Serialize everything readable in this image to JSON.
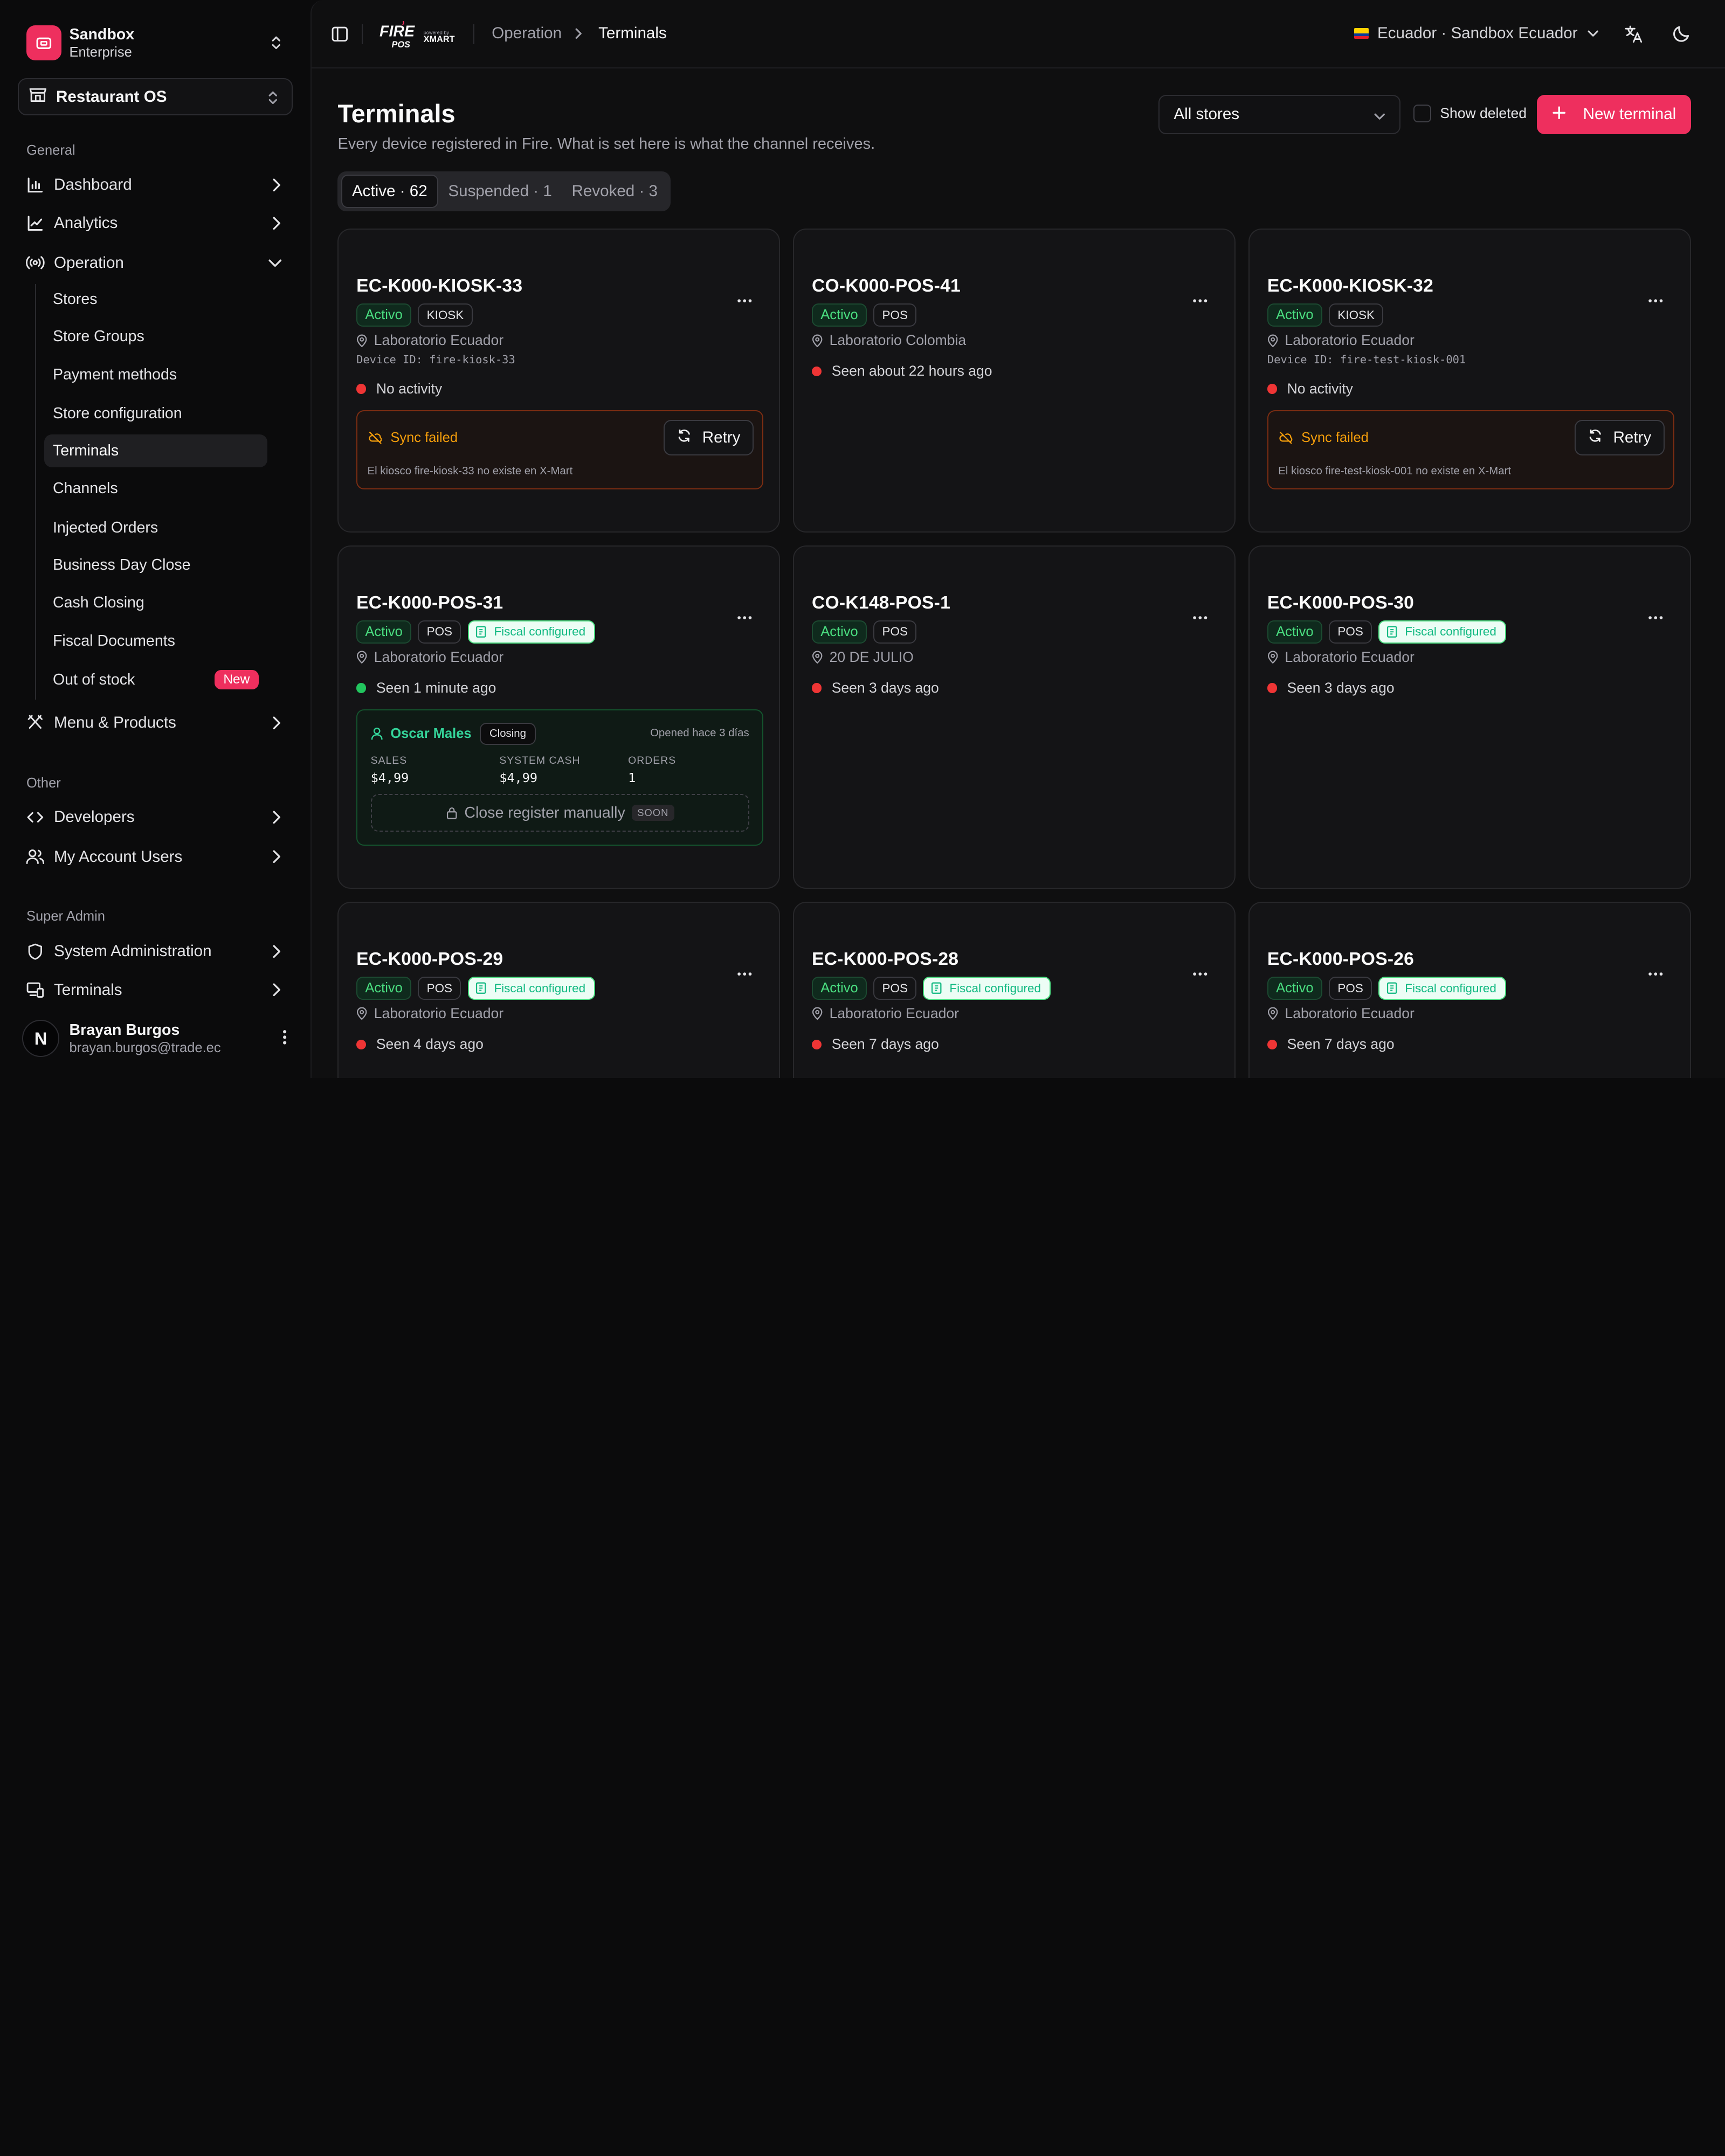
{
  "org": {
    "name": "Sandbox",
    "plan": "Enterprise"
  },
  "product": {
    "label": "Restaurant OS"
  },
  "sidebar": {
    "general_label": "General",
    "dashboard": "Dashboard",
    "analytics": "Analytics",
    "operation": "Operation",
    "sub": {
      "stores": "Stores",
      "store_groups": "Store Groups",
      "payment_methods": "Payment methods",
      "store_configuration": "Store configuration",
      "terminals": "Terminals",
      "channels": "Channels",
      "injected_orders": "Injected Orders",
      "business_day_close": "Business Day Close",
      "cash_closing": "Cash Closing",
      "fiscal_documents": "Fiscal Documents",
      "out_of_stock": "Out of stock",
      "new_badge": "New"
    },
    "menu_products": "Menu & Products",
    "other_label": "Other",
    "developers": "Developers",
    "my_account_users": "My Account Users",
    "super_admin_label": "Super Admin",
    "system_administration": "System Administration",
    "terminals": "Terminals"
  },
  "user": {
    "name": "Brayan Burgos",
    "email": "brayan.burgos@trade.ec",
    "initial": "N"
  },
  "topbar": {
    "brand_main": "FIRE",
    "brand_sub": "POS",
    "brand_powered": "powered by",
    "brand_partner": "XMART",
    "breadcrumb_parent": "Operation",
    "breadcrumb_current": "Terminals",
    "country": "Ecuador · Sandbox Ecuador"
  },
  "page": {
    "title": "Terminals",
    "subtitle": "Every device registered in Fire. What is set here is what the channel receives.",
    "store_filter": "All stores",
    "show_deleted": "Show deleted",
    "new_terminal": "New terminal"
  },
  "tabs": {
    "active": "Active · 62",
    "suspended": "Suspended · 1",
    "revoked": "Revoked · 3"
  },
  "colors": {
    "accent": "#ee2f5e",
    "status_green": "#4ade80",
    "status_red": "#ef3535",
    "warning": "#f59e0b"
  },
  "cards": [
    {
      "title": "EC-K000-KIOSK-33",
      "status": "Activo",
      "type": "KIOSK",
      "location": "Laboratorio Ecuador",
      "device_id": "Device ID: fire-kiosk-33",
      "seen": "No activity",
      "sync_title": "Sync failed",
      "sync_msg": "El kiosco fire-kiosk-33 no existe en X-Mart",
      "retry": "Retry"
    },
    {
      "title": "CO-K000-POS-41",
      "status": "Activo",
      "type": "POS",
      "location": "Laboratorio Colombia",
      "seen": "Seen about 22 hours ago"
    },
    {
      "title": "EC-K000-KIOSK-32",
      "status": "Activo",
      "type": "KIOSK",
      "location": "Laboratorio Ecuador",
      "device_id": "Device ID: fire-test-kiosk-001",
      "seen": "No activity",
      "sync_title": "Sync failed",
      "sync_msg": "El kiosco fire-test-kiosk-001 no existe en X-Mart",
      "retry": "Retry"
    },
    {
      "title": "EC-K000-POS-31",
      "status": "Activo",
      "type": "POS",
      "fiscal": "Fiscal configured",
      "location": "Laboratorio Ecuador",
      "seen": "Seen 1 minute ago",
      "session": {
        "user": "Oscar Males",
        "state": "Closing",
        "opened": "Opened hace 3 días",
        "sales_label": "SALES",
        "sales": "$4,99",
        "cash_label": "SYSTEM CASH",
        "cash": "$4,99",
        "orders_label": "ORDERS",
        "orders": "1",
        "close_label": "Close register manually",
        "soon": "SOON"
      }
    },
    {
      "title": "CO-K148-POS-1",
      "status": "Activo",
      "type": "POS",
      "location": "20 DE JULIO",
      "seen": "Seen 3 days ago"
    },
    {
      "title": "EC-K000-POS-30",
      "status": "Activo",
      "type": "POS",
      "fiscal": "Fiscal configured",
      "location": "Laboratorio Ecuador",
      "seen": "Seen 3 days ago"
    },
    {
      "title": "EC-K000-POS-29",
      "status": "Activo",
      "type": "POS",
      "fiscal": "Fiscal configured",
      "location": "Laboratorio Ecuador",
      "seen": "Seen 4 days ago"
    },
    {
      "title": "EC-K000-POS-28",
      "status": "Activo",
      "type": "POS",
      "fiscal": "Fiscal configured",
      "location": "Laboratorio Ecuador",
      "seen": "Seen 7 days ago"
    },
    {
      "title": "EC-K000-POS-26",
      "status": "Activo",
      "type": "POS",
      "fiscal": "Fiscal configured",
      "location": "Laboratorio Ecuador",
      "seen": "Seen 7 days ago"
    }
  ]
}
